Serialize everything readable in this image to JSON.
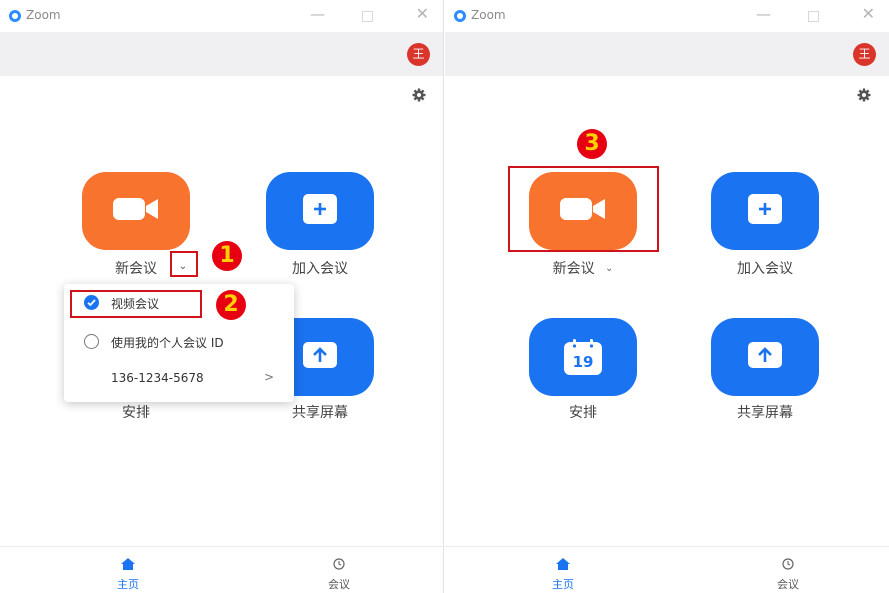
{
  "left": {
    "app_title": "Zoom",
    "avatar_text": "王",
    "tiles": {
      "new_meeting": "新会议",
      "join_meeting": "加入会议",
      "schedule": "安排",
      "share_screen": "共享屏幕"
    },
    "dropdown": {
      "video_meeting": "视频会议",
      "use_personal_id": "使用我的个人会议 ID",
      "personal_id": "136-1234-5678",
      "arrow": ">"
    },
    "nav": {
      "home": "主页",
      "meetings": "会议"
    },
    "callouts": [
      "1",
      "2"
    ]
  },
  "right": {
    "app_title": "Zoom",
    "avatar_text": "王",
    "tiles": {
      "new_meeting": "新会议",
      "join_meeting": "加入会议",
      "schedule": "安排",
      "share_screen": "共享屏幕",
      "calendar_day": "19"
    },
    "nav": {
      "home": "主页",
      "meetings": "会议"
    },
    "callouts": [
      "3"
    ]
  },
  "colors": {
    "accent_blue": "#1a73f0",
    "accent_orange": "#f7732e",
    "avatar_red": "#d9352b",
    "callout_red": "#e60012",
    "callout_text": "#ffd100"
  },
  "icons": [
    "zoom-logo-icon",
    "gear-icon",
    "video-camera-icon",
    "plus-icon",
    "calendar-icon",
    "share-up-arrow-icon",
    "home-icon",
    "clock-icon",
    "check-icon",
    "chevron-down-icon",
    "chevron-right-icon"
  ]
}
